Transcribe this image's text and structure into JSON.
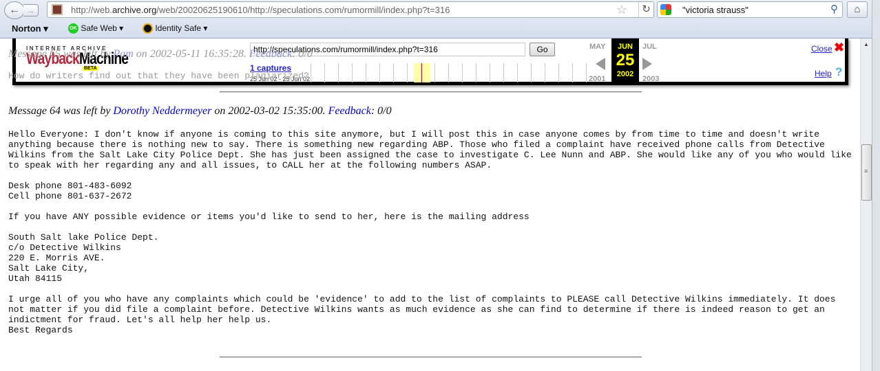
{
  "browser": {
    "url_prefix": "http://web.",
    "url_domain": "archive.org",
    "url_rest": "/web/20020625190610/http://speculations.com/rumormill/index.php?t=316",
    "search_query": "\"victoria strauss\"",
    "icons": {
      "back": "back-arrow-icon",
      "forward": "forward-arrow-icon",
      "star": "bookmark-star-icon",
      "reload": "reload-icon",
      "search": "magnifier-icon",
      "home": "home-icon"
    }
  },
  "norton": {
    "brand": "Norton",
    "safe_web": "Safe Web",
    "ok": "OK",
    "identity_safe": "Identity Safe"
  },
  "wayback": {
    "logo_top": "INTERNET ARCHIVE",
    "logo_wayback": "Wayback",
    "logo_machine": "Machine",
    "logo_beta": "BETA",
    "url_value": "http://speculations.com/rumormill/index.php?t=316",
    "go_label": "Go",
    "captures": "1 captures",
    "range": "25 Jun 02 - 25 Jun 02",
    "prev_month": "MAY",
    "cur_month": "JUN",
    "next_month": "JUL",
    "cur_day": "25",
    "prev_year": "2001",
    "cur_year": "2002",
    "next_year": "2003",
    "close": "Close",
    "help": "Help",
    "colors": {
      "highlight": "#ffffa8",
      "capture": "#d01050",
      "current_bg": "#000000",
      "current_fg": "#ffff00"
    }
  },
  "messages": [
    {
      "prefix": "Message 65 was left by ",
      "author": "Pam",
      "middle": " on 2002-05-11 16:35:28. ",
      "feedback": "Feedback",
      "score": ": 0/0",
      "body": "How do writers find out that they have been plagiarized?"
    },
    {
      "prefix": "Message 64 was left by ",
      "author": "Dorothy Neddermeyer",
      "middle": " on 2002-03-02 15:35:00. ",
      "feedback": "Feedback",
      "score": ": 0/0",
      "body": "Hello Everyone: I don't know if anyone is coming to this site anymore, but I will post this in case anyone comes by from time to time and doesn't write anything because there is nothing new to say. There is something new regarding ABP. Those who filed a complaint have received phone calls from Detective Wilkins from the Salt Lake City Police Dept. She has just been assigned the case to investigate C. Lee Nunn and ABP. She would like any of you who would like to speak with her regarding any and all issues, to CALL her at the following numbers ASAP.\n\nDesk phone 801-483-6092\nCell phone 801-637-2672\n\nIf you have ANY possible evidence or items you'd like to send to her, here is the mailing address\n\nSouth Salt lake Police Dept.\nc/o Detective Wilkins\n220 E. Morris AVE.\nSalt Lake City,\nUtah 84115\n\nI urge all of you who have any complaints which could be 'evidence' to add to the list of complaints to PLEASE call Detective Wilkins immediately. It does not matter if you did file a complaint before. Detective Wilkins wants as much evidence as she can find to determine if there is indeed reason to get an indictment for fraud. Let's all help her help us.\nBest Regards"
    }
  ]
}
